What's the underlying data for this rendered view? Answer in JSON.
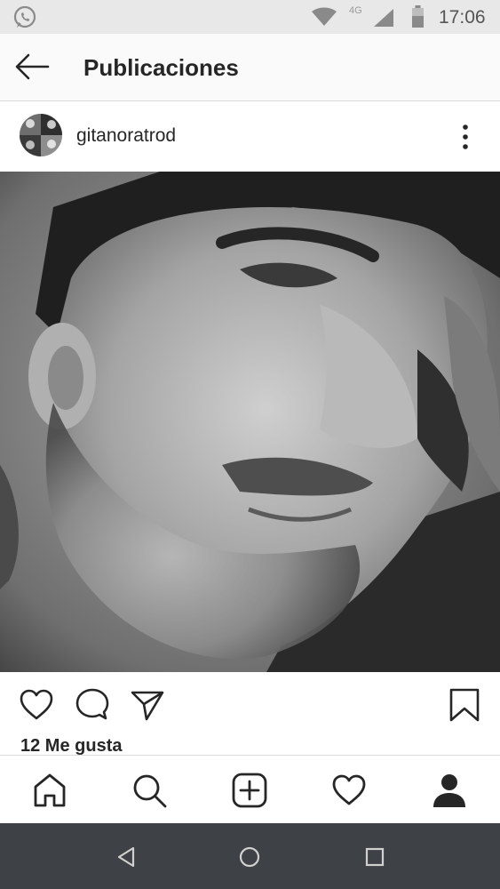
{
  "status_bar": {
    "time": "17:06",
    "network": "4G",
    "icons": [
      "whatsapp-icon",
      "wifi-icon",
      "signal-icon",
      "battery-icon"
    ]
  },
  "header": {
    "title": "Publicaciones",
    "back_icon": "arrow-left-icon"
  },
  "post": {
    "username": "gitanoratrod",
    "more_icon": "vertical-dots-icon",
    "likes": "12 Me gusta",
    "actions": [
      "heart-icon",
      "comment-icon",
      "send-icon",
      "bookmark-icon"
    ]
  },
  "bottom_nav": {
    "items": [
      "home-icon",
      "search-icon",
      "add-icon",
      "activity-heart-icon",
      "profile-icon"
    ]
  },
  "android_nav": {
    "items": [
      "back-triangle-icon",
      "home-circle-icon",
      "recents-square-icon"
    ]
  },
  "colors": {
    "text": "#262626",
    "status_bar_bg": "#e8e8e8",
    "header_bg": "#fafafa",
    "android_nav_bg": "#3e4145"
  }
}
